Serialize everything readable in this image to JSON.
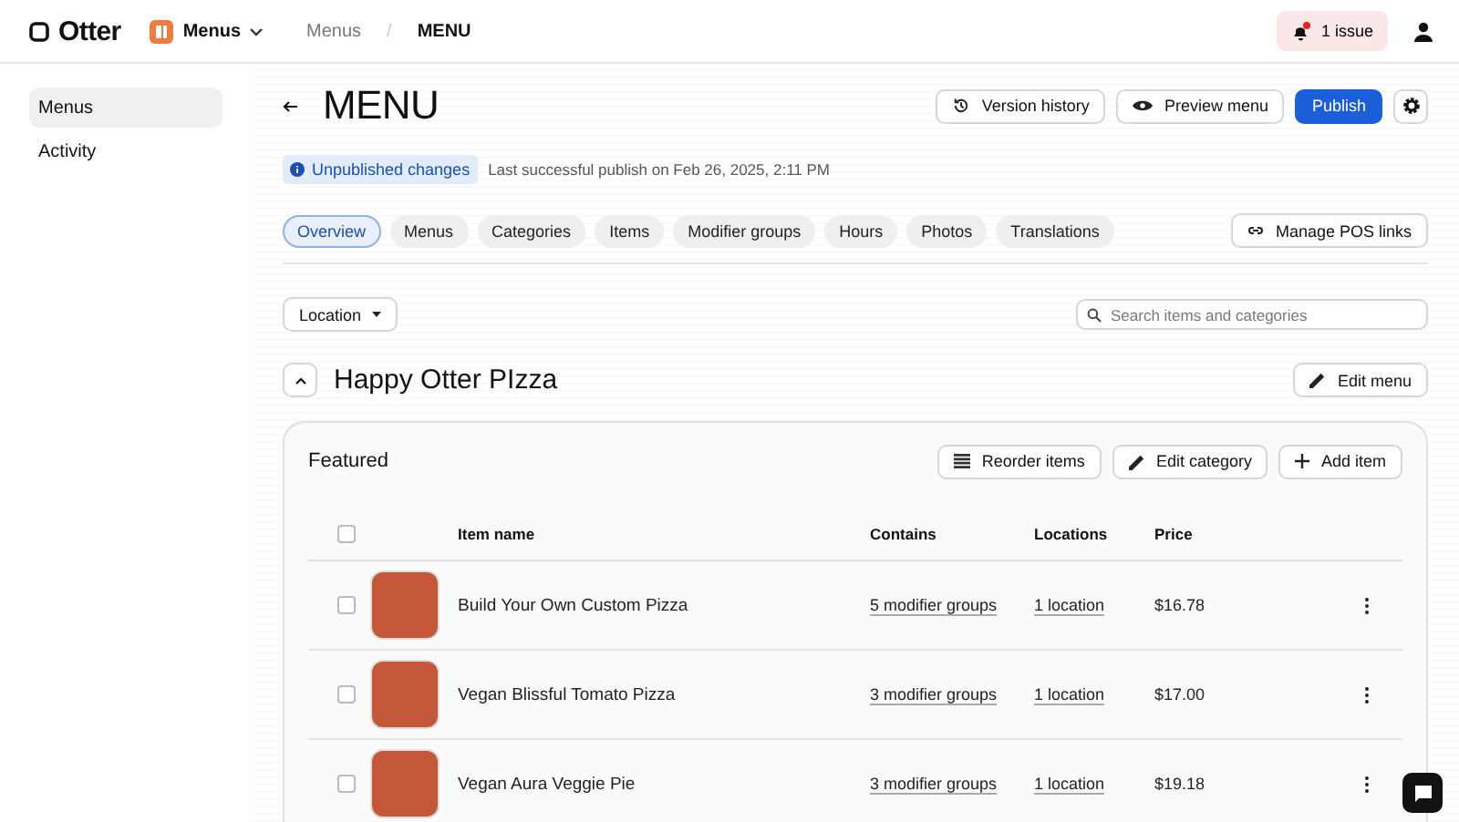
{
  "topbar": {
    "logo": "Otter",
    "app_switcher": "Menus",
    "breadcrumbs": [
      {
        "label": "Menus",
        "selected": false
      },
      {
        "label": "MENU",
        "selected": true
      }
    ],
    "breadcrumb_separator": "/",
    "issues": "1 issue"
  },
  "sidebar": {
    "items": [
      {
        "label": "Menus",
        "selected": true
      },
      {
        "label": "Activity",
        "selected": false
      }
    ]
  },
  "header": {
    "title": "MENU",
    "buttons": [
      {
        "label": "Version history",
        "kind": "history"
      },
      {
        "label": "Preview menu",
        "kind": "preview"
      },
      {
        "label": "Publish",
        "kind": "primary"
      }
    ],
    "status_badge": "Unpublished changes",
    "status_text": "Last successful publish on Feb 26, 2025, 2:11 PM"
  },
  "tabs": [
    {
      "label": "Overview",
      "selected": true
    },
    {
      "label": "Menus",
      "selected": false
    },
    {
      "label": "Categories",
      "selected": false
    },
    {
      "label": "Items",
      "selected": false
    },
    {
      "label": "Modifier groups",
      "selected": false
    },
    {
      "label": "Hours",
      "selected": false
    },
    {
      "label": "Photos",
      "selected": false
    },
    {
      "label": "Translations",
      "selected": false
    }
  ],
  "manage_pos_links": "Manage POS links",
  "filter": {
    "label": "Location"
  },
  "search": {
    "placeholder": "Search items and categories"
  },
  "menu": {
    "name": "Happy Otter PIzza",
    "edit_button": "Edit menu",
    "expanded": true
  },
  "category": {
    "name": "Featured",
    "all_checked": false,
    "actions": [
      {
        "label": "Reorder items",
        "kind": "reorder"
      },
      {
        "label": "Edit category",
        "kind": "edit"
      },
      {
        "label": "Add item",
        "kind": "add"
      }
    ],
    "columns": [
      "Item name",
      "Contains",
      "Locations",
      "Price"
    ],
    "rows": [
      {
        "name": "Build Your Own Custom Pizza",
        "contains": "5 modifier groups",
        "locations": "1 location",
        "price": "$16.78",
        "checked": false
      },
      {
        "name": "Vegan Blissful Tomato Pizza",
        "contains": "3 modifier groups",
        "locations": "1 location",
        "price": "$17.00",
        "checked": false
      },
      {
        "name": "Vegan Aura Veggie Pie",
        "contains": "3 modifier groups",
        "locations": "1 location",
        "price": "$19.18",
        "checked": false
      }
    ]
  }
}
